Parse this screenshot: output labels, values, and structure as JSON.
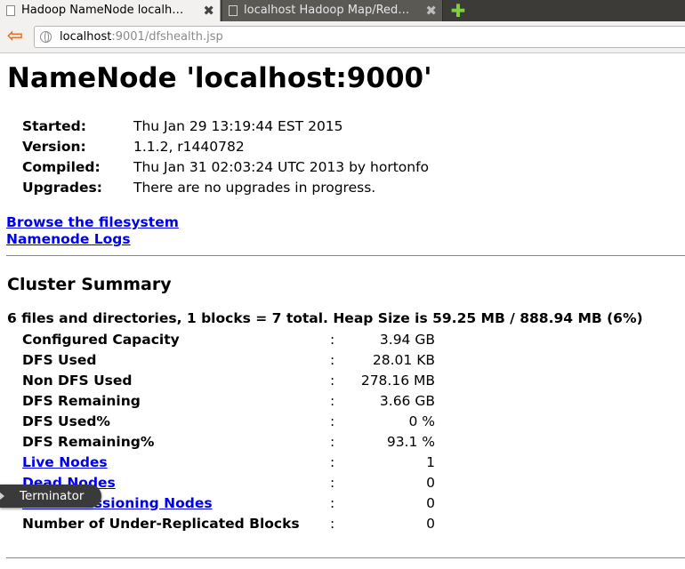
{
  "browser": {
    "tabs": [
      {
        "title": "Hadoop NameNode localh…",
        "close": "✖"
      },
      {
        "title": "localhost Hadoop Map/Red…",
        "close": "✖"
      }
    ],
    "new_tab": "✚",
    "back": "⇦",
    "url_host": "localhost",
    "url_rest": ":9001/dfshealth.jsp"
  },
  "page": {
    "title": "NameNode 'localhost:9000'",
    "info": [
      {
        "label": "Started:",
        "value": "Thu Jan 29 13:19:44 EST 2015"
      },
      {
        "label": "Version:",
        "value": "1.1.2, r1440782"
      },
      {
        "label": "Compiled:",
        "value": "Thu Jan 31 02:03:24 UTC 2013 by hortonfo"
      },
      {
        "label": "Upgrades:",
        "value": "There are no upgrades in progress."
      }
    ],
    "links": {
      "browse": "Browse the filesystem",
      "logs": "Namenode Logs"
    },
    "cluster_summary": {
      "heading": "Cluster Summary",
      "summary_line": "6 files and directories, 1 blocks = 7 total. Heap Size is 59.25 MB / 888.94 MB (6%)",
      "separator": ":",
      "rows": [
        {
          "label": "Configured Capacity",
          "value": "3.94 GB"
        },
        {
          "label": "DFS Used",
          "value": "28.01 KB"
        },
        {
          "label": "Non DFS Used",
          "value": "278.16 MB"
        },
        {
          "label": "DFS Remaining",
          "value": "3.66 GB"
        },
        {
          "label": "DFS Used%",
          "value": "0 %"
        },
        {
          "label": "DFS Remaining%",
          "value": "93.1 %"
        },
        {
          "label": "Live Nodes",
          "value": "1"
        },
        {
          "label": "Dead Nodes",
          "value": "0"
        },
        {
          "label": "Decommissioning Nodes",
          "value": "0"
        },
        {
          "label": "Number of Under-Replicated Blocks",
          "value": "0"
        }
      ]
    }
  },
  "tooltip": {
    "text": "Terminator"
  }
}
